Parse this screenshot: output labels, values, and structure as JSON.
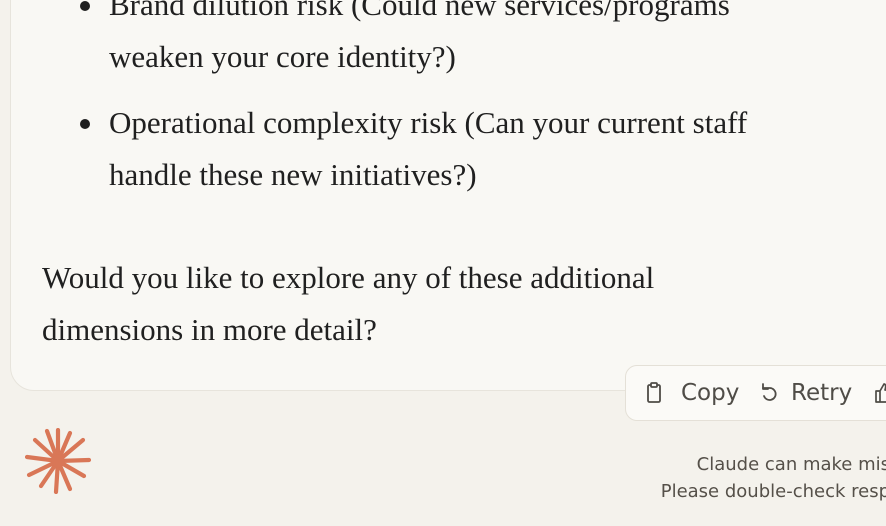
{
  "message": {
    "bullets": [
      {
        "line_1": "Brand dilution risk (Could new services/programs",
        "line_2": "weaken your core identity?)"
      },
      {
        "line_1": "Operational complexity risk (Can your current staff",
        "line_2": "handle these new initiatives?)"
      }
    ],
    "closing": {
      "line_1": "Would you like to explore any of these additional",
      "line_2": "dimensions in more detail?"
    }
  },
  "actions": {
    "copy_label": "Copy",
    "retry_label": "Retry",
    "copy_icon": "clipboard-icon",
    "retry_icon": "undo-icon",
    "thumb_icon": "thumbs-up-icon"
  },
  "footer": {
    "disclaimer_line_1": "Claude can make mis",
    "disclaimer_line_2": "Please double-check resp",
    "logo_icon": "claude-starburst-icon"
  },
  "colors": {
    "page_background": "#f4f2ec",
    "message_background": "#f9f8f4",
    "text": "#202020",
    "muted_text": "#555049",
    "brand": "#d97757"
  }
}
